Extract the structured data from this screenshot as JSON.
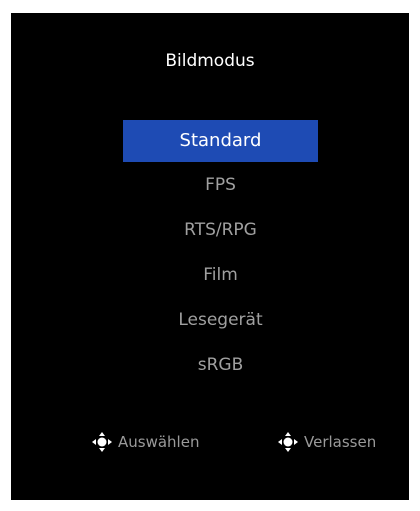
{
  "menu": {
    "title": "Bildmodus",
    "items": [
      {
        "label": "Standard",
        "selected": true
      },
      {
        "label": "FPS",
        "selected": false
      },
      {
        "label": "RTS/RPG",
        "selected": false
      },
      {
        "label": "Film",
        "selected": false
      },
      {
        "label": "Lesegerät",
        "selected": false
      },
      {
        "label": "sRGB",
        "selected": false
      }
    ]
  },
  "footer": {
    "select": {
      "icon": "joystick-icon",
      "label": "Auswählen"
    },
    "exit": {
      "icon": "joystick-icon",
      "label": "Verlassen"
    }
  },
  "colors": {
    "background": "#000000",
    "selection": "#1e4bb4",
    "text_active": "#ffffff",
    "text_inactive": "#a0a0a0"
  }
}
